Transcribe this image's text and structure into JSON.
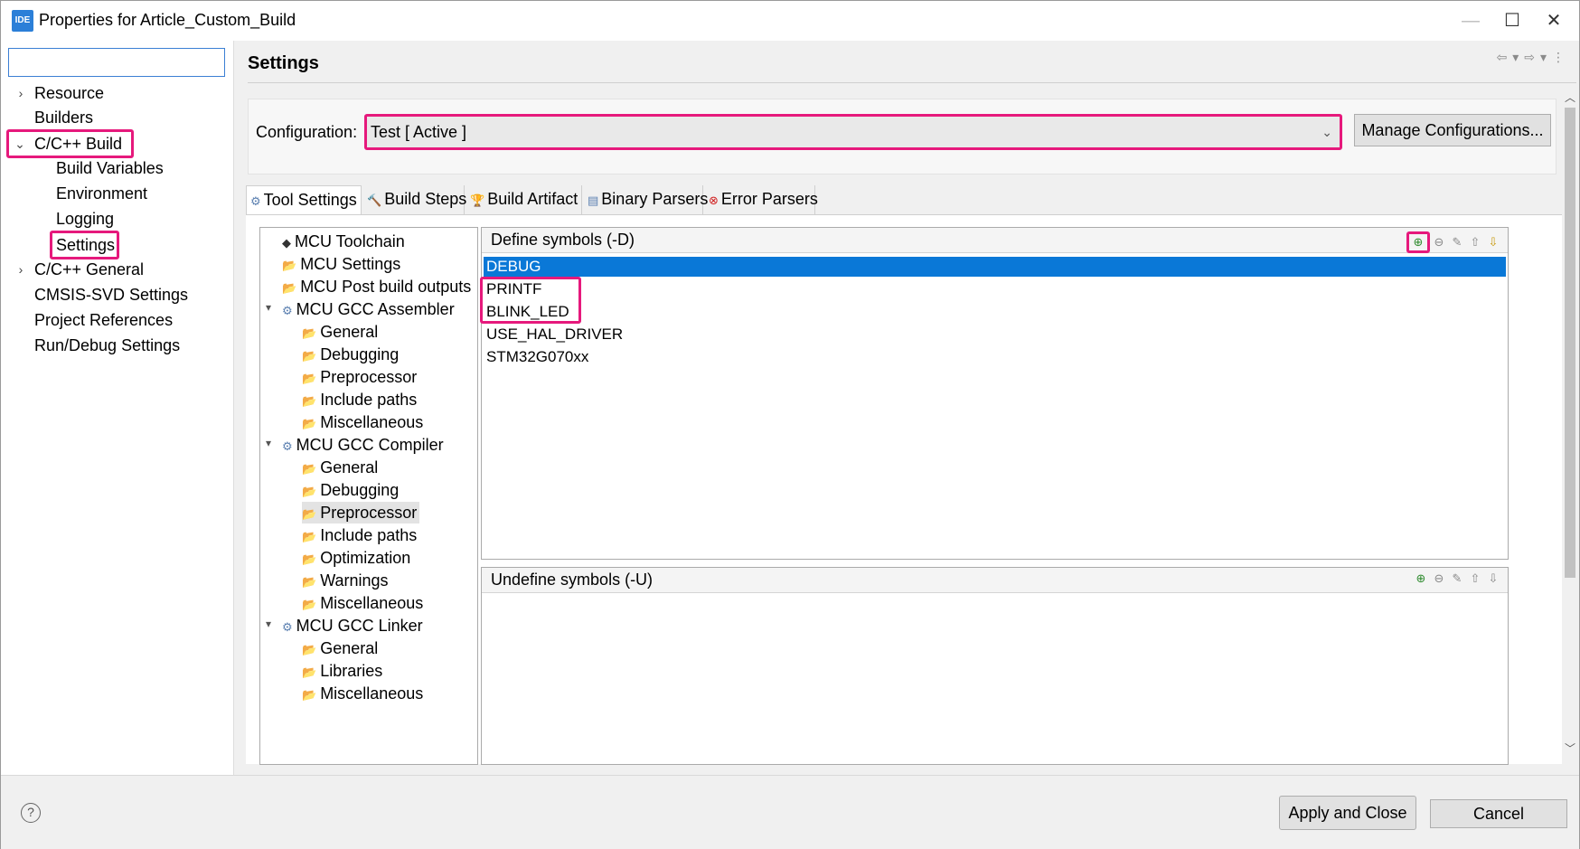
{
  "window": {
    "app_icon": "IDE",
    "title": "Properties for Article_Custom_Build",
    "minimize": "—",
    "maximize": "☐",
    "close": "✕"
  },
  "filter": {
    "value": "",
    "placeholder": ""
  },
  "nav": {
    "items": [
      {
        "label": "Resource"
      },
      {
        "label": "Builders"
      },
      {
        "label": "C/C++ Build"
      },
      {
        "label": "Build Variables"
      },
      {
        "label": "Environment"
      },
      {
        "label": "Logging"
      },
      {
        "label": "Settings"
      },
      {
        "label": "C/C++ General"
      },
      {
        "label": "CMSIS-SVD Settings"
      },
      {
        "label": "Project References"
      },
      {
        "label": "Run/Debug Settings"
      }
    ]
  },
  "page": {
    "title": "Settings"
  },
  "configuration": {
    "label": "Configuration:",
    "value": "Test  [ Active ]",
    "manage_label": "Manage Configurations..."
  },
  "tabs": [
    {
      "label": "Tool Settings",
      "icon": "tool-settings-icon"
    },
    {
      "label": "Build Steps",
      "icon": "build-steps-icon"
    },
    {
      "label": "Build Artifact",
      "icon": "build-artifact-icon"
    },
    {
      "label": "Binary Parsers",
      "icon": "binary-parsers-icon"
    },
    {
      "label": "Error Parsers",
      "icon": "error-parsers-icon"
    }
  ],
  "tool_tree": [
    {
      "label": "MCU Toolchain"
    },
    {
      "label": "MCU Settings"
    },
    {
      "label": "MCU Post build outputs"
    },
    {
      "label": "MCU GCC Assembler"
    },
    {
      "label": "General"
    },
    {
      "label": "Debugging"
    },
    {
      "label": "Preprocessor"
    },
    {
      "label": "Include paths"
    },
    {
      "label": "Miscellaneous"
    },
    {
      "label": "MCU GCC Compiler"
    },
    {
      "label": "General"
    },
    {
      "label": "Debugging"
    },
    {
      "label": "Preprocessor"
    },
    {
      "label": "Include paths"
    },
    {
      "label": "Optimization"
    },
    {
      "label": "Warnings"
    },
    {
      "label": "Miscellaneous"
    },
    {
      "label": "MCU GCC Linker"
    },
    {
      "label": "General"
    },
    {
      "label": "Libraries"
    },
    {
      "label": "Miscellaneous"
    }
  ],
  "define_symbols": {
    "title": "Define symbols (-D)",
    "items": [
      "DEBUG",
      "PRINTF",
      "BLINK_LED",
      "USE_HAL_DRIVER",
      "STM32G070xx"
    ]
  },
  "undefine_symbols": {
    "title": "Undefine symbols (-U)",
    "items": []
  },
  "buttons": {
    "apply_close": "Apply and Close",
    "cancel": "Cancel",
    "help": "?"
  },
  "colors": {
    "highlight": "#e6197c",
    "selection": "#0a78d7"
  }
}
